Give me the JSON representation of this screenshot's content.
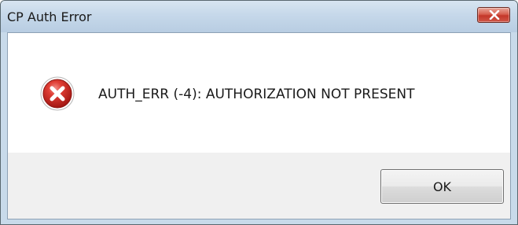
{
  "window": {
    "title": "CP Auth Error",
    "close_icon": "close-icon"
  },
  "message": {
    "icon": "error-icon",
    "text": "AUTH_ERR (-4): AUTHORIZATION NOT PRESENT"
  },
  "buttons": {
    "ok_label": "OK"
  },
  "colors": {
    "error_red": "#c9201e",
    "close_button_red": "#c4372a",
    "titlebar_blue": "#c6d8ea"
  }
}
